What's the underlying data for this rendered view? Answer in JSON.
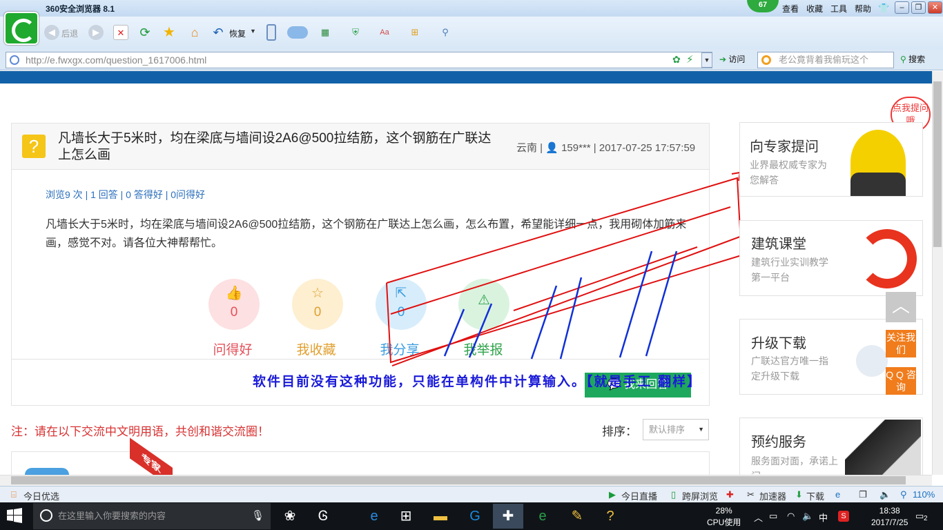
{
  "browser": {
    "title": "360安全浏览器 8.1",
    "badge": "67",
    "menu": [
      "查看",
      "收藏",
      "工具",
      "帮助"
    ],
    "back_label": "后退",
    "restore_label": "恢复",
    "url_host": "http://e.fwxgx.com",
    "url_path": "/question_1617006.html",
    "visit_label": "访问",
    "search_placeholder": "老公竟背着我偷玩这个",
    "search_label": "搜索",
    "window_controls": [
      "–",
      "❐",
      "✕"
    ]
  },
  "question": {
    "title": "凡墙长大于5米时，均在梁底与墙间设2A6@500拉结筋，这个钢筋在广联达上怎么画",
    "meta": "云南 | 👤 159*** | 2017-07-25 17:57:59",
    "stats": "浏览9 次 | 1 回答 | 0 答得好 | 0问得好",
    "body": "凡墙长大于5米时，均在梁底与墙间设2A6@500拉结筋，这个钢筋在广联达上怎么画，怎么布置，希望能详细一点，我用砌体加筋来画，感觉不对。请各位大神帮帮忙。",
    "actions": [
      {
        "count": "0",
        "label": "问得好",
        "color": "#e4505a",
        "bg": "#fde0e2"
      },
      {
        "count": "0",
        "label": "我收藏",
        "color": "#e0a030",
        "bg": "#fdefd0"
      },
      {
        "count": "0",
        "label": "我分享",
        "color": "#3a9ce0",
        "bg": "#d8edfb"
      },
      {
        "count": "",
        "label": "我举报",
        "color": "#2fa34a",
        "bg": "#daf3df"
      }
    ],
    "answer_button": "我来回答",
    "overlay_text": "软件目前没有这种功能，只能在单构件中计算输入。【就是手工 翻样】"
  },
  "comments": {
    "note": "注：请在以下交流中文明用语，共创和谐交流圈！",
    "sort_label": "排序：",
    "sort_value": "默认排序",
    "expert_tag": "专家"
  },
  "sidebar": {
    "bubble": "点我提问哦",
    "cards": [
      {
        "title": "向专家提问",
        "desc": "业界最权威专家为您解答"
      },
      {
        "title": "建筑课堂",
        "desc": "建筑行业实训教学第一平台"
      },
      {
        "title": "升级下载",
        "desc": "广联达官方唯一指定升级下载"
      },
      {
        "title": "预约服务",
        "desc": "服务面对面，承诺上门"
      }
    ],
    "follow_label": "关注我们",
    "qq_label": "Q Q 咨询"
  },
  "statusbar": {
    "left": "今日优选",
    "items": [
      "今日直播",
      "跨屏浏览",
      "加速器",
      "下载"
    ],
    "zoom": "110%"
  },
  "taskbar": {
    "search_placeholder": "在这里输入你要搜索的内容",
    "cpu_percent": "28%",
    "cpu_label": "CPU使用",
    "ime": "中",
    "time": "18:38",
    "date": "2017/7/25",
    "notifications": "2"
  }
}
